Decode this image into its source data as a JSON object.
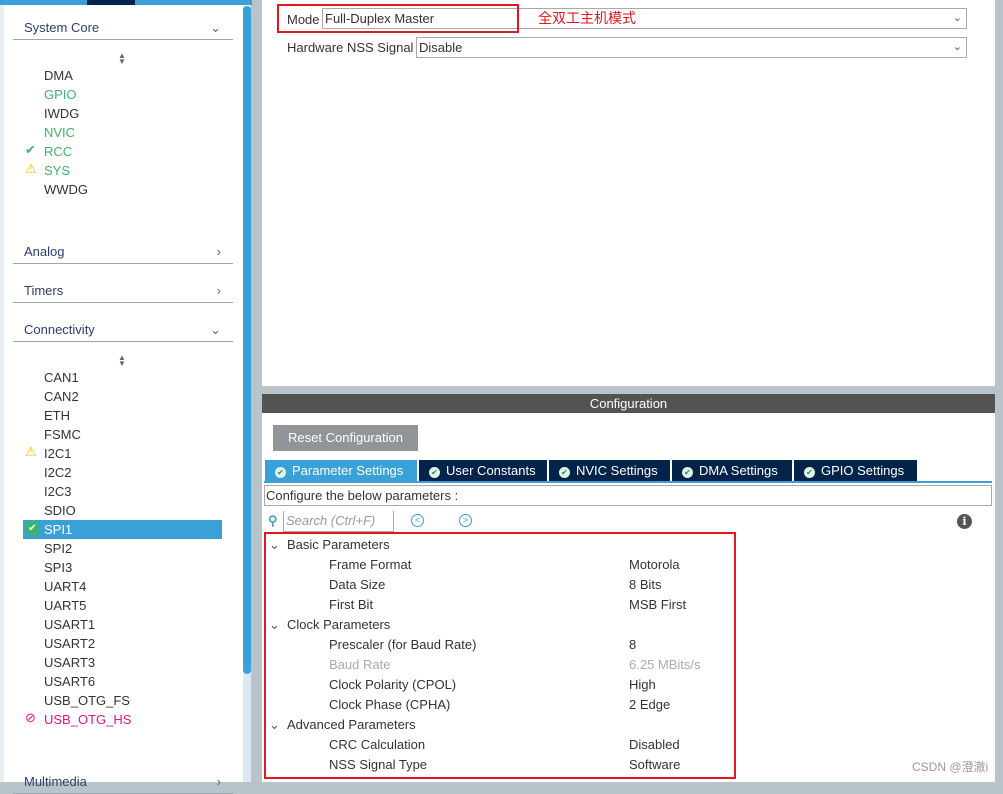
{
  "sidebar": {
    "categories": [
      {
        "label": "System Core",
        "state": "expanded"
      },
      {
        "label": "Analog",
        "state": "collapsed"
      },
      {
        "label": "Timers",
        "state": "collapsed"
      },
      {
        "label": "Connectivity",
        "state": "expanded"
      },
      {
        "label": "Multimedia",
        "state": "collapsed"
      }
    ],
    "system_core": [
      {
        "label": "DMA",
        "status": "none"
      },
      {
        "label": "GPIO",
        "status": "configured"
      },
      {
        "label": "IWDG",
        "status": "none"
      },
      {
        "label": "NVIC",
        "status": "configured"
      },
      {
        "label": "RCC",
        "status": "ok"
      },
      {
        "label": "SYS",
        "status": "warning"
      },
      {
        "label": "WWDG",
        "status": "none"
      }
    ],
    "connectivity": [
      {
        "label": "CAN1"
      },
      {
        "label": "CAN2"
      },
      {
        "label": "ETH"
      },
      {
        "label": "FSMC"
      },
      {
        "label": "I2C1",
        "status": "warning"
      },
      {
        "label": "I2C2"
      },
      {
        "label": "I2C3"
      },
      {
        "label": "SDIO"
      },
      {
        "label": "SPI1",
        "status": "ok-selected"
      },
      {
        "label": "SPI2"
      },
      {
        "label": "SPI3"
      },
      {
        "label": "UART4"
      },
      {
        "label": "UART5"
      },
      {
        "label": "USART1"
      },
      {
        "label": "USART2"
      },
      {
        "label": "USART3"
      },
      {
        "label": "USART6"
      },
      {
        "label": "USB_OTG_FS"
      },
      {
        "label": "USB_OTG_HS",
        "status": "disabled"
      }
    ]
  },
  "mode": {
    "mode_label": "Mode",
    "mode_value": "Full-Duplex Master",
    "annotation": "全双工主机模式",
    "nss_label": "Hardware NSS Signal",
    "nss_value": "Disable"
  },
  "config": {
    "title": "Configuration",
    "reset_label": "Reset Configuration",
    "tabs": [
      {
        "label": "Parameter Settings",
        "active": true
      },
      {
        "label": "User Constants"
      },
      {
        "label": "NVIC Settings"
      },
      {
        "label": "DMA Settings"
      },
      {
        "label": "GPIO Settings"
      }
    ],
    "hint": "Configure the below parameters :",
    "search_placeholder": "Search (Ctrl+F)",
    "groups": [
      {
        "label": "Basic Parameters",
        "params": [
          {
            "name": "Frame Format",
            "value": "Motorola"
          },
          {
            "name": "Data Size",
            "value": "8 Bits"
          },
          {
            "name": "First Bit",
            "value": "MSB First"
          }
        ]
      },
      {
        "label": "Clock Parameters",
        "params": [
          {
            "name": "Prescaler (for Baud Rate)",
            "value": "8"
          },
          {
            "name": "Baud Rate",
            "value": "6.25 MBits/s",
            "disabled": true
          },
          {
            "name": "Clock Polarity (CPOL)",
            "value": "High"
          },
          {
            "name": "Clock Phase (CPHA)",
            "value": "2 Edge"
          }
        ]
      },
      {
        "label": "Advanced Parameters",
        "params": [
          {
            "name": "CRC Calculation",
            "value": "Disabled"
          },
          {
            "name": "NSS Signal Type",
            "value": "Software"
          }
        ]
      }
    ]
  },
  "watermark": "CSDN @澄澈i",
  "colors": {
    "accent": "#3aa0d8",
    "navy": "#03234b",
    "highlight": "#e5161f",
    "ok": "#3bb56a",
    "error": "#e0157f"
  }
}
